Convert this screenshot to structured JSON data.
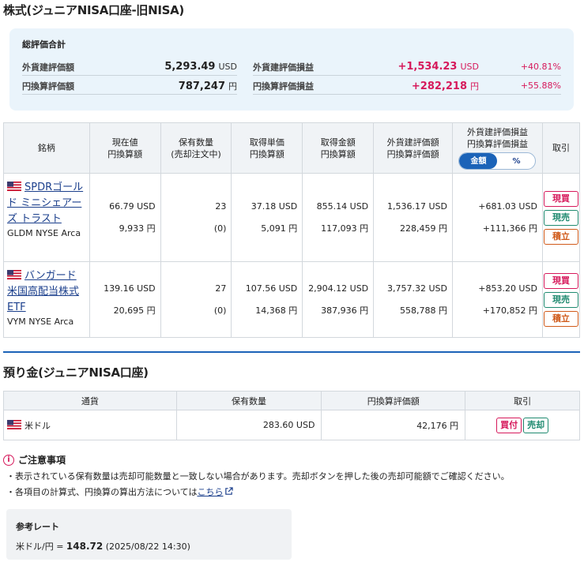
{
  "page_title": "株式(ジュニアNISA口座-旧NISA)",
  "summary": {
    "title": "総評価合計",
    "fx_value_label": "外貨建評価額",
    "fx_value": "5,293.49",
    "fx_value_unit": "USD",
    "jpy_value_label": "円換算評価額",
    "jpy_value": "787,247",
    "jpy_value_unit": "円",
    "fx_pl_label": "外貨建評価損益",
    "fx_pl": "+1,534.23",
    "fx_pl_unit": "USD",
    "fx_pl_pct": "+40.81%",
    "jpy_pl_label": "円換算評価損益",
    "jpy_pl": "+282,218",
    "jpy_pl_unit": "円",
    "jpy_pl_pct": "+55.88%"
  },
  "holdings": {
    "headers": {
      "name": "銘柄",
      "price1": "現在値",
      "price2": "円換算額",
      "qty1": "保有数量",
      "qty2": "(売却注文中)",
      "cost1": "取得単価",
      "cost2": "円換算額",
      "amount1": "取得金額",
      "amount2": "円換算額",
      "value1": "外貨建評価額",
      "value2": "円換算評価額",
      "pl1": "外貨建評価損益",
      "pl2": "円換算評価損益",
      "toggle_amount": "金額",
      "toggle_pct": "%",
      "action": "取引"
    },
    "buttons": {
      "buy": "現買",
      "sell": "現売",
      "accumulate": "積立"
    },
    "rows": [
      {
        "name": "SPDRゴールド ミニシェアーズ トラスト",
        "ticker": "GLDM NYSE Arca",
        "price_usd": "66.79 USD",
        "price_jpy": "9,933 円",
        "qty": "23",
        "qty_pending": "(0)",
        "cost_usd": "37.18 USD",
        "cost_jpy": "5,091 円",
        "amount_usd": "855.14 USD",
        "amount_jpy": "117,093 円",
        "value_usd": "1,536.17 USD",
        "value_jpy": "228,459 円",
        "pl_usd": "+681.03 USD",
        "pl_jpy": "+111,366 円"
      },
      {
        "name": "バンガード 米国高配当株式ETF",
        "ticker": "VYM NYSE Arca",
        "price_usd": "139.16 USD",
        "price_jpy": "20,695 円",
        "qty": "27",
        "qty_pending": "(0)",
        "cost_usd": "107.56 USD",
        "cost_jpy": "14,368 円",
        "amount_usd": "2,904.12 USD",
        "amount_jpy": "387,936 円",
        "value_usd": "3,757.32 USD",
        "value_jpy": "558,788 円",
        "pl_usd": "+853.20 USD",
        "pl_jpy": "+170,852 円"
      }
    ]
  },
  "deposit": {
    "title": "預り金(ジュニアNISA口座)",
    "headers": {
      "currency": "通貨",
      "qty": "保有数量",
      "jpy": "円換算評価額",
      "action": "取引"
    },
    "row": {
      "currency": "米ドル",
      "qty": "283.60 USD",
      "jpy": "42,176 円"
    },
    "buy_label": "買付",
    "sell_label": "売却"
  },
  "notes": {
    "title": "ご注意事項",
    "line1": "・表示されている保有数量は売却可能数量と一致しない場合があります。売却ボタンを押した後の売却可能額でご確認ください。",
    "line2_prefix": "・各項目の計算式、円換算の算出方法については",
    "line2_link": "こちら"
  },
  "rate": {
    "title": "参考レート",
    "label": "米ドル/円 =",
    "value": "148.72",
    "timestamp": "(2025/08/22 14:30)"
  },
  "colors": {
    "positive": "#d6195b",
    "link": "#1b3f8c",
    "accent": "#1b63b8",
    "sell": "#1f8a70",
    "accumulate": "#d05a1a"
  }
}
